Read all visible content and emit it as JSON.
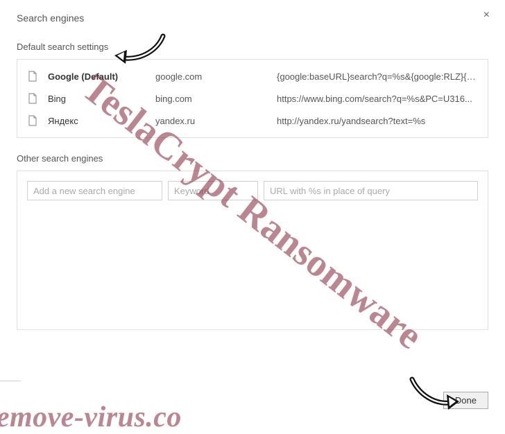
{
  "dialog": {
    "title": "Search engines",
    "close_symbol": "×"
  },
  "default_section": {
    "label": "Default search settings",
    "engines": [
      {
        "name": "Google (Default)",
        "keyword": "google.com",
        "url": "{google:baseURL}search?q=%s&{google:RLZ}{g...",
        "is_default": true
      },
      {
        "name": "Bing",
        "keyword": "bing.com",
        "url": "https://www.bing.com/search?q=%s&PC=U316...",
        "is_default": false
      },
      {
        "name": "Яндекс",
        "keyword": "yandex.ru",
        "url": "http://yandex.ru/yandsearch?text=%s",
        "is_default": false
      }
    ]
  },
  "other_section": {
    "label": "Other search engines",
    "placeholders": {
      "name": "Add a new search engine",
      "keyword": "Keyword",
      "url": "URL with %s in place of query"
    }
  },
  "buttons": {
    "done": "Done"
  },
  "watermark": {
    "diagonal": "TeslaCrypt Ransomware",
    "bottom": "remove-virus.co"
  }
}
